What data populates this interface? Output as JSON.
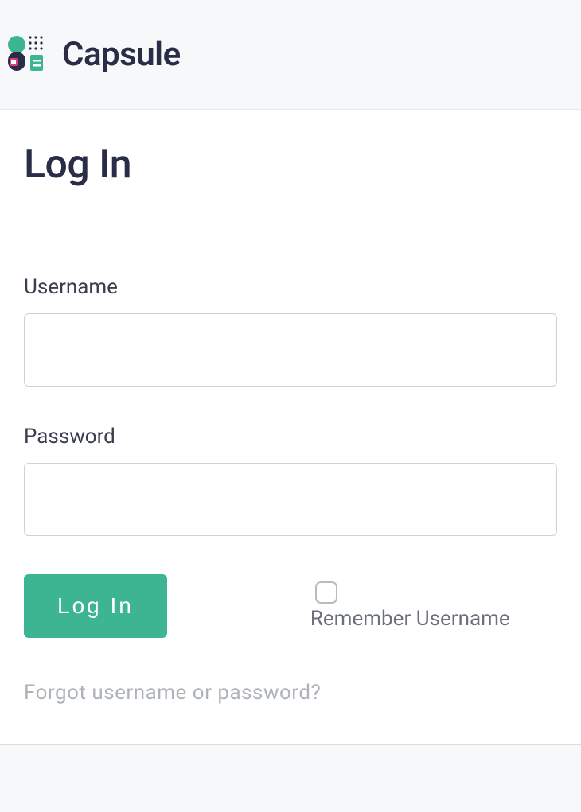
{
  "brand": {
    "name": "Capsule"
  },
  "page": {
    "title": "Log In"
  },
  "form": {
    "username": {
      "label": "Username",
      "value": ""
    },
    "password": {
      "label": "Password",
      "value": ""
    },
    "submit_label": "Log In",
    "remember": {
      "label": "Remember Username",
      "checked": false
    },
    "forgot_link": "Forgot username or password?"
  },
  "colors": {
    "accent": "#3db592",
    "text_dark": "#2a2d47",
    "text_muted": "#6b6f7a",
    "text_faint": "#aeb3b9"
  }
}
